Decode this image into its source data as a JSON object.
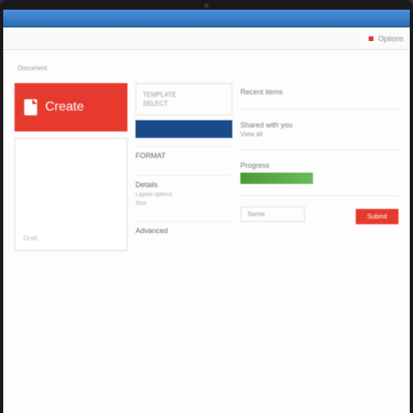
{
  "titlebar": {
    "title": ""
  },
  "toolbar": {
    "left_label": "",
    "right_label": "Options"
  },
  "header": {
    "col1": "Document",
    "col2": "",
    "col3": ""
  },
  "red_card": {
    "label": "Create"
  },
  "gray_card": {
    "placeholder": "Draft"
  },
  "col2": {
    "header_line1": "TEMPLATE",
    "header_line2": "SELECT",
    "section1_title": "FORMAT",
    "section1_sub": "",
    "section2_title": "Details",
    "section2_sub1": "Layout options",
    "section2_sub2": "Size",
    "section3_title": "Advanced",
    "section3_sub": ""
  },
  "col3": {
    "block1_title": "Recent items",
    "block1_sub": "",
    "block2_title": "Shared with you",
    "block2_sub": "View all",
    "block3_title": "Progress",
    "block3_sub": "",
    "field_label": "Name",
    "button_label": "Submit"
  },
  "footer": {
    "label": ""
  }
}
